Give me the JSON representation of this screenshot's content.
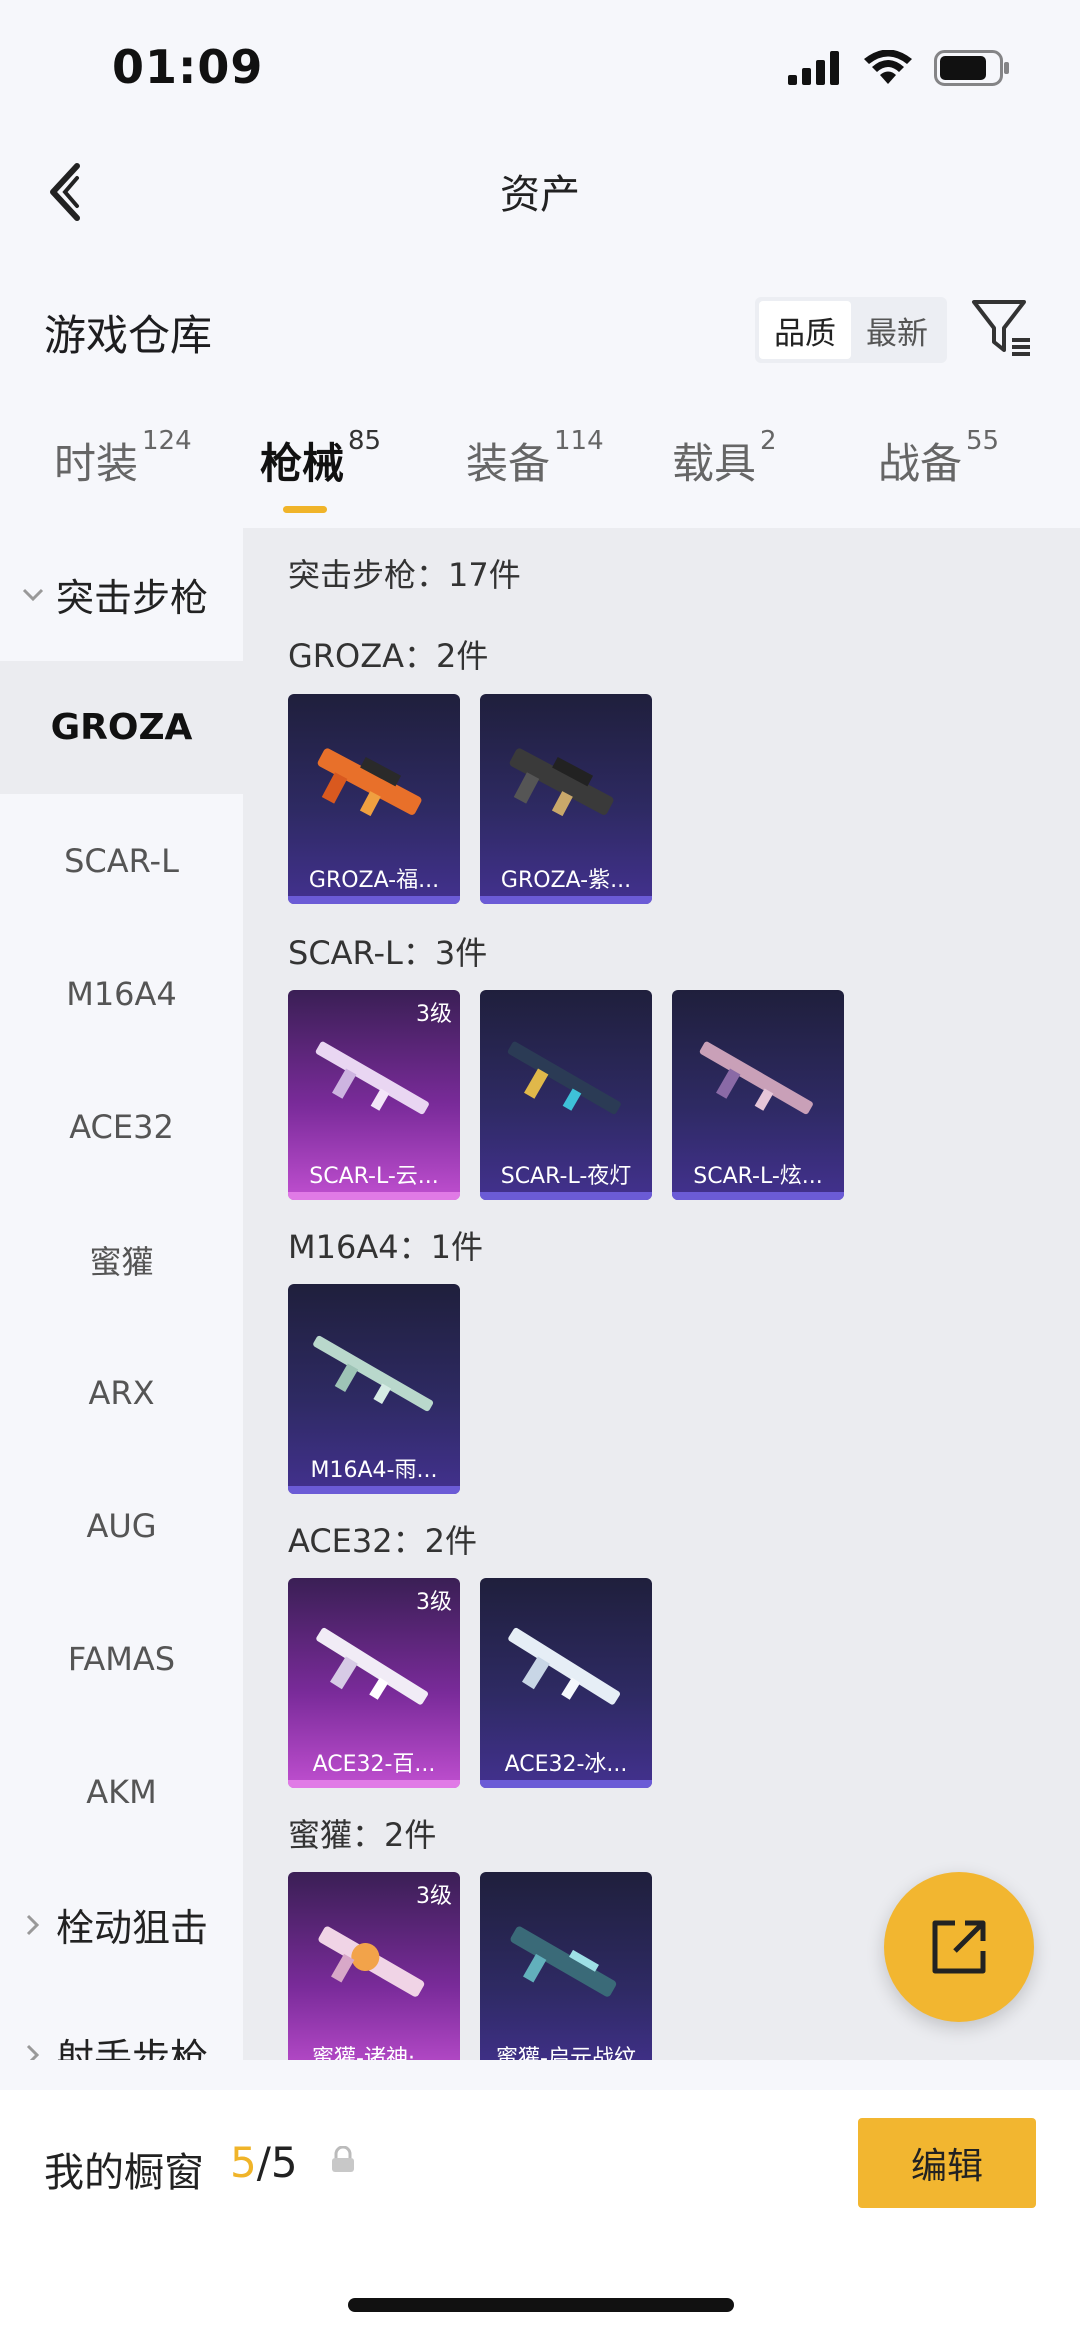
{
  "status_bar": {
    "time": "01:09"
  },
  "header": {
    "title": "资产"
  },
  "warehouse": {
    "title": "游戏仓库",
    "sort_options": [
      "品质",
      "最新"
    ],
    "sort_selected": "品质"
  },
  "tabs": [
    {
      "label": "时装",
      "count": "124",
      "active": false
    },
    {
      "label": "枪械",
      "count": "85",
      "active": true
    },
    {
      "label": "装备",
      "count": "114",
      "active": false
    },
    {
      "label": "载具",
      "count": "2",
      "active": false
    },
    {
      "label": "战备",
      "count": "55",
      "active": false
    }
  ],
  "sidebar": {
    "category_open": "突击步枪",
    "items": [
      "GROZA",
      "SCAR-L",
      "M16A4",
      "ACE32",
      "蜜獾",
      "ARX",
      "AUG",
      "FAMAS",
      "AKM"
    ],
    "active_item": "GROZA",
    "category_collapsed_1": "栓动狙击",
    "category_collapsed_2": "射手步枪"
  },
  "content": {
    "category_total": "突击步枪：17件",
    "groups": [
      {
        "label": "GROZA：2件",
        "cards": [
          {
            "name": "GROZA-福...",
            "level": "",
            "quality": "normal"
          },
          {
            "name": "GROZA-紫...",
            "level": "",
            "quality": "normal"
          }
        ]
      },
      {
        "label": "SCAR-L：3件",
        "cards": [
          {
            "name": "SCAR-L-云...",
            "level": "3级",
            "quality": "q3"
          },
          {
            "name": "SCAR-L-夜灯",
            "level": "",
            "quality": "normal"
          },
          {
            "name": "SCAR-L-炫...",
            "level": "",
            "quality": "normal"
          }
        ]
      },
      {
        "label": "M16A4：1件",
        "cards": [
          {
            "name": "M16A4-雨...",
            "level": "",
            "quality": "normal"
          }
        ]
      },
      {
        "label": "ACE32：2件",
        "cards": [
          {
            "name": "ACE32-百...",
            "level": "3级",
            "quality": "q3"
          },
          {
            "name": "ACE32-冰...",
            "level": "",
            "quality": "normal"
          }
        ]
      },
      {
        "label": "蜜獾：2件",
        "cards": [
          {
            "name": "蜜獾-诸神·...",
            "level": "3级",
            "quality": "q3"
          },
          {
            "name": "蜜獾-启元战纹",
            "level": "",
            "quality": "normal"
          }
        ]
      }
    ]
  },
  "bottom_bar": {
    "showcase_label": "我的橱窗",
    "showcase_current": "5",
    "showcase_total": "/5",
    "edit_label": "编辑"
  },
  "colors": {
    "accent": "#f2b630",
    "accent_text": "#f0b429"
  },
  "icons": [
    "signal-icon",
    "wifi-icon",
    "battery-icon",
    "back-arrow-icon",
    "filter-icon",
    "share-icon",
    "lock-icon",
    "chevron-down-icon",
    "chevron-right-icon",
    "gun-icon"
  ]
}
